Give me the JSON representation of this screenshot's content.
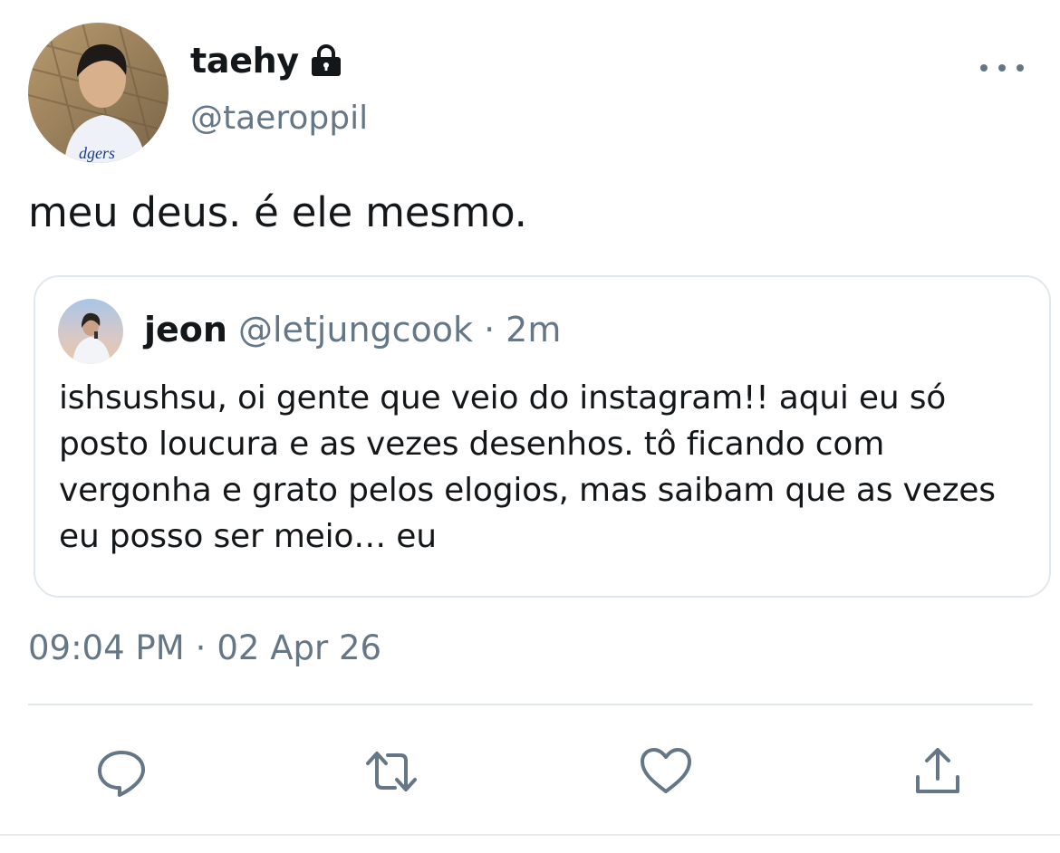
{
  "author": {
    "display_name": "taehy",
    "handle": "@taeroppil",
    "protected_icon": "lock-icon",
    "avatar_icon": "profile-photo"
  },
  "tweet": {
    "text": "meu deus. é ele mesmo."
  },
  "quoted_tweet": {
    "display_name": "jeon",
    "handle": "@letjungcook",
    "separator": "·",
    "time": "2m",
    "text": "ishsushsu, oi gente que veio do instagram!! aqui eu só posto loucura e as vezes desenhos. tô ficando com vergonha e grato pelos elogios, mas saibam que as vezes eu posso ser meio… eu"
  },
  "timestamp": {
    "time": "09:04 PM",
    "separator": "·",
    "date": "02 Apr 26"
  },
  "actions": {
    "reply_icon": "reply-icon",
    "retweet_icon": "retweet-icon",
    "like_icon": "heart-icon",
    "share_icon": "share-icon",
    "more_icon": "more-horizontal-icon"
  },
  "colors": {
    "text_primary": "#14171a",
    "text_secondary": "#657786",
    "border": "#e1e8ed",
    "background": "#ffffff"
  }
}
